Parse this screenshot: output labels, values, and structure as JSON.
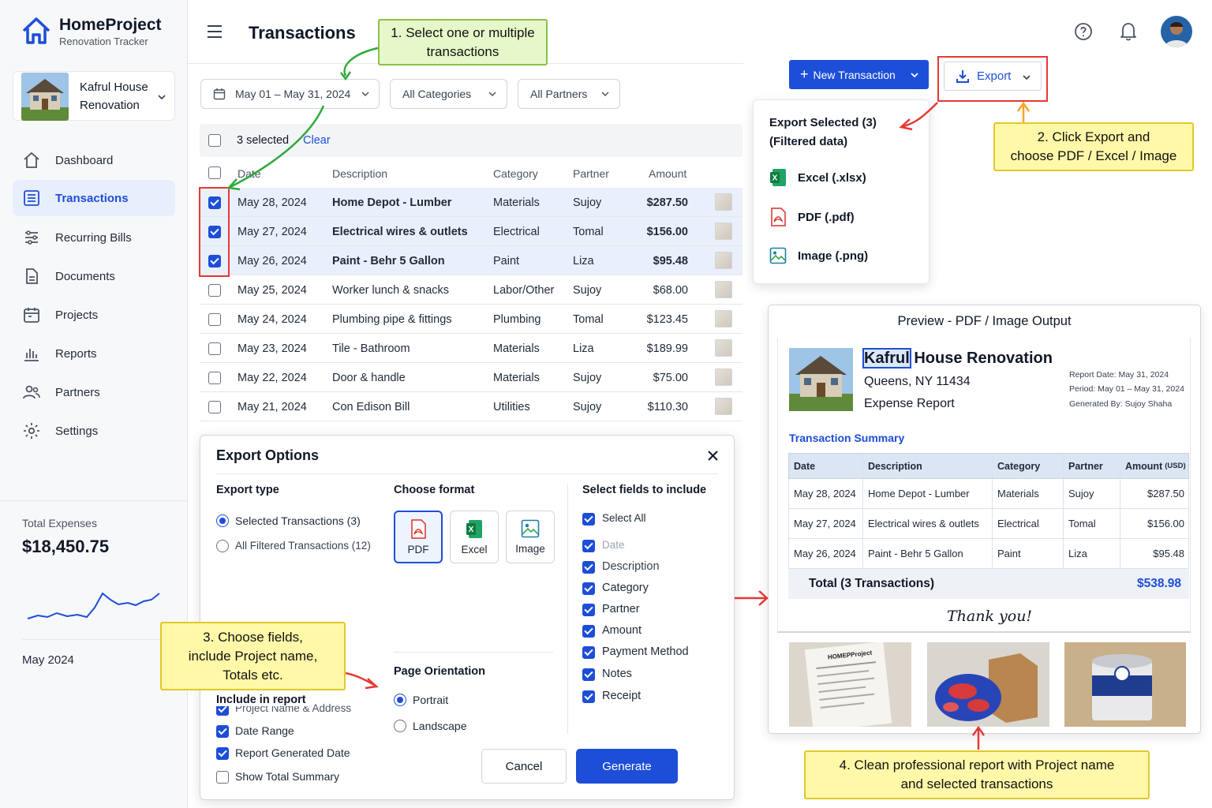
{
  "brand": {
    "title": "HomeProject",
    "subtitle": "Renovation Tracker"
  },
  "project": {
    "name_line1": "Kafrul House",
    "name_line2": "Renovation"
  },
  "nav": [
    {
      "label": "Dashboard",
      "icon": "home-icon"
    },
    {
      "label": "Transactions",
      "icon": "list-icon",
      "active": true
    },
    {
      "label": "Recurring Bills",
      "icon": "recurring-icon"
    },
    {
      "label": "Documents",
      "icon": "document-icon"
    },
    {
      "label": "Projects",
      "icon": "calendar-icon"
    },
    {
      "label": "Reports",
      "icon": "chart-icon"
    },
    {
      "label": "Partners",
      "icon": "users-icon"
    },
    {
      "label": "Settings",
      "icon": "gear-icon"
    }
  ],
  "totals": {
    "label": "Total Expenses",
    "amount": "$18,450.75",
    "month": "May 2024"
  },
  "header": {
    "title": "Transactions",
    "new_transaction": "New Transaction",
    "export": "Export"
  },
  "filters": {
    "date_range": "May 01 – May 31, 2024",
    "category": "All Categories",
    "partner": "All Partners"
  },
  "selection": {
    "count_text": "3 selected",
    "clear": "Clear"
  },
  "table": {
    "columns": [
      "Date",
      "Description",
      "Category",
      "Partner",
      "Amount"
    ],
    "rows": [
      {
        "date": "May 28, 2024",
        "description": "Home Depot - Lumber",
        "category": "Materials",
        "partner": "Sujoy",
        "amount": "$287.50",
        "selected": true
      },
      {
        "date": "May 27, 2024",
        "description": "Electrical wires & outlets",
        "category": "Electrical",
        "partner": "Tomal",
        "amount": "$156.00",
        "selected": true
      },
      {
        "date": "May 26, 2024",
        "description": "Paint - Behr 5 Gallon",
        "category": "Paint",
        "partner": "Liza",
        "amount": "$95.48",
        "selected": true
      },
      {
        "date": "May 25, 2024",
        "description": "Worker lunch & snacks",
        "category": "Labor/Other",
        "partner": "Sujoy",
        "amount": "$68.00",
        "selected": false
      },
      {
        "date": "May 24, 2024",
        "description": "Plumbing pipe & fittings",
        "category": "Plumbing",
        "partner": "Tomal",
        "amount": "$123.45",
        "selected": false
      },
      {
        "date": "May 23, 2024",
        "description": "Tile - Bathroom",
        "category": "Materials",
        "partner": "Liza",
        "amount": "$189.99",
        "selected": false
      },
      {
        "date": "May 22, 2024",
        "description": "Door & handle",
        "category": "Materials",
        "partner": "Sujoy",
        "amount": "$75.00",
        "selected": false
      },
      {
        "date": "May 21, 2024",
        "description": "Con Edison Bill",
        "category": "Utilities",
        "partner": "Sujoy",
        "amount": "$110.30",
        "selected": false
      }
    ]
  },
  "export_menu": {
    "header_line1": "Export Selected (3)",
    "header_line2": "(Filtered data)",
    "excel": "Excel (.xlsx)",
    "pdf": "PDF (.pdf)",
    "image": "Image (.png)"
  },
  "dialog": {
    "title": "Export Options",
    "export_type_heading": "Export type",
    "export_type_selected": "Selected Transactions (3)",
    "export_type_all": "All Filtered Transactions (12)",
    "format_heading": "Choose format",
    "formats": [
      "PDF",
      "Excel",
      "Image"
    ],
    "fields_heading": "Select fields to include",
    "fields": [
      "Select All",
      "Date",
      "Description",
      "Category",
      "Partner",
      "Amount",
      "Payment Method",
      "Notes",
      "Receipt"
    ],
    "orientation_heading": "Page Orientation",
    "orientation_portrait": "Portrait",
    "orientation_landscape": "Landscape",
    "include_heading": "Include in report",
    "include_items": [
      {
        "label": "Project Name & Address",
        "checked": true
      },
      {
        "label": "Date Range",
        "checked": true
      },
      {
        "label": "Report Generated Date",
        "checked": true
      },
      {
        "label": "Show Total Summary",
        "checked": false
      }
    ],
    "cancel": "Cancel",
    "generate": "Generate"
  },
  "preview": {
    "title": "Preview - PDF / Image Output",
    "project_name_first": "Kafrul",
    "project_name_rest": " House Renovation",
    "address": "Queens, NY 11434",
    "report_type": "Expense Report",
    "report_date": "Report Date: May 31, 2024",
    "period": "Period: May 01 – May 31, 2024",
    "generated_by": "Generated By: Sujoy Shaha",
    "summary_heading": "Transaction Summary",
    "columns": [
      "Date",
      "Description",
      "Category",
      "Partner",
      "Amount"
    ],
    "amount_unit": "(USD)",
    "rows": [
      {
        "date": "May 28, 2024",
        "description": "Home Depot - Lumber",
        "category": "Materials",
        "partner": "Sujoy",
        "amount": "$287.50"
      },
      {
        "date": "May 27, 2024",
        "description": "Electrical wires & outlets",
        "category": "Electrical",
        "partner": "Tomal",
        "amount": "$156.00"
      },
      {
        "date": "May 26, 2024",
        "description": "Paint - Behr 5 Gallon",
        "category": "Paint",
        "partner": "Liza",
        "amount": "$95.48"
      }
    ],
    "total_label": "Total (3 Transactions)",
    "total_value": "$538.98",
    "thanks": "Thank you!",
    "receipt_text": "HOMEPProject"
  },
  "callouts": {
    "step1": [
      "1.  Select one or multiple",
      "transactions"
    ],
    "step2": [
      "2.  Click Export and",
      "choose PDF / Excel / Image"
    ],
    "step3": [
      "3.  Choose fields,",
      "include Project name,",
      "Totals etc."
    ],
    "step4": [
      "4.  Clean professional report with Project name",
      "and selected transactions"
    ]
  },
  "colors": {
    "primary": "#1d4ed8",
    "callout_yellow": "#fff8a8",
    "callout_green": "#e6f7c9",
    "annotation_red": "#e53935"
  }
}
